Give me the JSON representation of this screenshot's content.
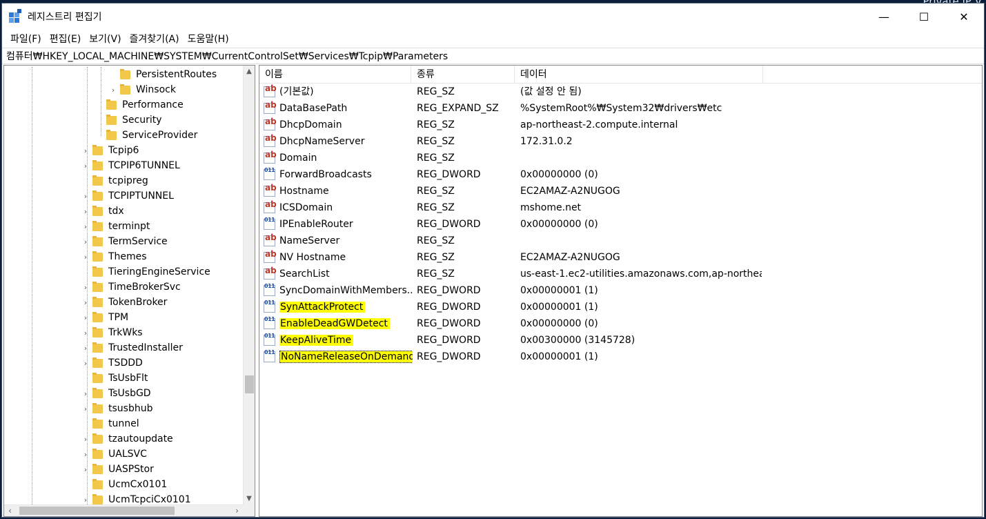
{
  "window": {
    "title": "레지스트리 편집기",
    "controls": {
      "minimize": "—",
      "maximize": "☐",
      "close": "✕"
    },
    "desktop_fragment": "Private IP V"
  },
  "menu": [
    "파일(F)",
    "편집(E)",
    "보기(V)",
    "즐겨찾기(A)",
    "도움말(H)"
  ],
  "address": "컴퓨터₩HKEY_LOCAL_MACHINE₩SYSTEM₩CurrentControlSet₩Services₩Tcpip₩Parameters",
  "tree": [
    {
      "label": "PersistentRoutes",
      "indent": 2,
      "expandable": false
    },
    {
      "label": "Winsock",
      "indent": 2,
      "expandable": true
    },
    {
      "label": "Performance",
      "indent": 1,
      "expandable": false
    },
    {
      "label": "Security",
      "indent": 1,
      "expandable": false
    },
    {
      "label": "ServiceProvider",
      "indent": 1,
      "expandable": false
    },
    {
      "label": "Tcpip6",
      "indent": 0,
      "expandable": true
    },
    {
      "label": "TCPIP6TUNNEL",
      "indent": 0,
      "expandable": true
    },
    {
      "label": "tcpipreg",
      "indent": 0,
      "expandable": false
    },
    {
      "label": "TCPIPTUNNEL",
      "indent": 0,
      "expandable": true
    },
    {
      "label": "tdx",
      "indent": 0,
      "expandable": true
    },
    {
      "label": "terminpt",
      "indent": 0,
      "expandable": true
    },
    {
      "label": "TermService",
      "indent": 0,
      "expandable": true
    },
    {
      "label": "Themes",
      "indent": 0,
      "expandable": true
    },
    {
      "label": "TieringEngineService",
      "indent": 0,
      "expandable": false
    },
    {
      "label": "TimeBrokerSvc",
      "indent": 0,
      "expandable": true
    },
    {
      "label": "TokenBroker",
      "indent": 0,
      "expandable": true
    },
    {
      "label": "TPM",
      "indent": 0,
      "expandable": true
    },
    {
      "label": "TrkWks",
      "indent": 0,
      "expandable": true
    },
    {
      "label": "TrustedInstaller",
      "indent": 0,
      "expandable": true
    },
    {
      "label": "TSDDD",
      "indent": 0,
      "expandable": true
    },
    {
      "label": "TsUsbFlt",
      "indent": 0,
      "expandable": false
    },
    {
      "label": "TsUsbGD",
      "indent": 0,
      "expandable": true
    },
    {
      "label": "tsusbhub",
      "indent": 0,
      "expandable": true
    },
    {
      "label": "tunnel",
      "indent": 0,
      "expandable": false
    },
    {
      "label": "tzautoupdate",
      "indent": 0,
      "expandable": true
    },
    {
      "label": "UALSVC",
      "indent": 0,
      "expandable": true
    },
    {
      "label": "UASPStor",
      "indent": 0,
      "expandable": true
    },
    {
      "label": "UcmCx0101",
      "indent": 0,
      "expandable": false
    },
    {
      "label": "UcmTcpciCx0101",
      "indent": 0,
      "expandable": true
    }
  ],
  "list": {
    "columns": [
      "이름",
      "종류",
      "데이터"
    ],
    "rows": [
      {
        "name": "(기본값)",
        "type": "REG_SZ",
        "data": "(값 설정 안 됨)",
        "icon": "string-value-icon",
        "highlight": false
      },
      {
        "name": "DataBasePath",
        "type": "REG_EXPAND_SZ",
        "data": "%SystemRoot%₩System32₩drivers₩etc",
        "icon": "string-value-icon",
        "highlight": false
      },
      {
        "name": "DhcpDomain",
        "type": "REG_SZ",
        "data": "ap-northeast-2.compute.internal",
        "icon": "string-value-icon",
        "highlight": false
      },
      {
        "name": "DhcpNameServer",
        "type": "REG_SZ",
        "data": "172.31.0.2",
        "icon": "string-value-icon",
        "highlight": false
      },
      {
        "name": "Domain",
        "type": "REG_SZ",
        "data": "",
        "icon": "string-value-icon",
        "highlight": false
      },
      {
        "name": "ForwardBroadcasts",
        "type": "REG_DWORD",
        "data": "0x00000000 (0)",
        "icon": "dword-value-icon",
        "highlight": false
      },
      {
        "name": "Hostname",
        "type": "REG_SZ",
        "data": "EC2AMAZ-A2NUGOG",
        "icon": "string-value-icon",
        "highlight": false
      },
      {
        "name": "ICSDomain",
        "type": "REG_SZ",
        "data": "mshome.net",
        "icon": "string-value-icon",
        "highlight": false
      },
      {
        "name": "IPEnableRouter",
        "type": "REG_DWORD",
        "data": "0x00000000 (0)",
        "icon": "dword-value-icon",
        "highlight": false
      },
      {
        "name": "NameServer",
        "type": "REG_SZ",
        "data": "",
        "icon": "string-value-icon",
        "highlight": false
      },
      {
        "name": "NV Hostname",
        "type": "REG_SZ",
        "data": "EC2AMAZ-A2NUGOG",
        "icon": "string-value-icon",
        "highlight": false
      },
      {
        "name": "SearchList",
        "type": "REG_SZ",
        "data": "us-east-1.ec2-utilities.amazonaws.com,ap-northea...",
        "icon": "string-value-icon",
        "highlight": false
      },
      {
        "name": "SyncDomainWithMembers...",
        "type": "REG_DWORD",
        "data": "0x00000001 (1)",
        "icon": "dword-value-icon",
        "highlight": false
      },
      {
        "name": "SynAttackProtect",
        "type": "REG_DWORD",
        "data": "0x00000001 (1)",
        "icon": "dword-value-icon",
        "highlight": true
      },
      {
        "name": "EnableDeadGWDetect",
        "type": "REG_DWORD",
        "data": "0x00000000 (0)",
        "icon": "dword-value-icon",
        "highlight": true
      },
      {
        "name": "KeepAliveTime",
        "type": "REG_DWORD",
        "data": "0x00300000 (3145728)",
        "icon": "dword-value-icon",
        "highlight": true
      },
      {
        "name": "NoNameReleaseOnDemand",
        "type": "REG_DWORD",
        "data": "0x00000001 (1)",
        "icon": "dword-value-icon",
        "highlight": true,
        "selected": true
      }
    ]
  },
  "colors": {
    "highlight": "#ffff00",
    "folder": "#f2c84b",
    "desktop": "#0b1f3a"
  }
}
